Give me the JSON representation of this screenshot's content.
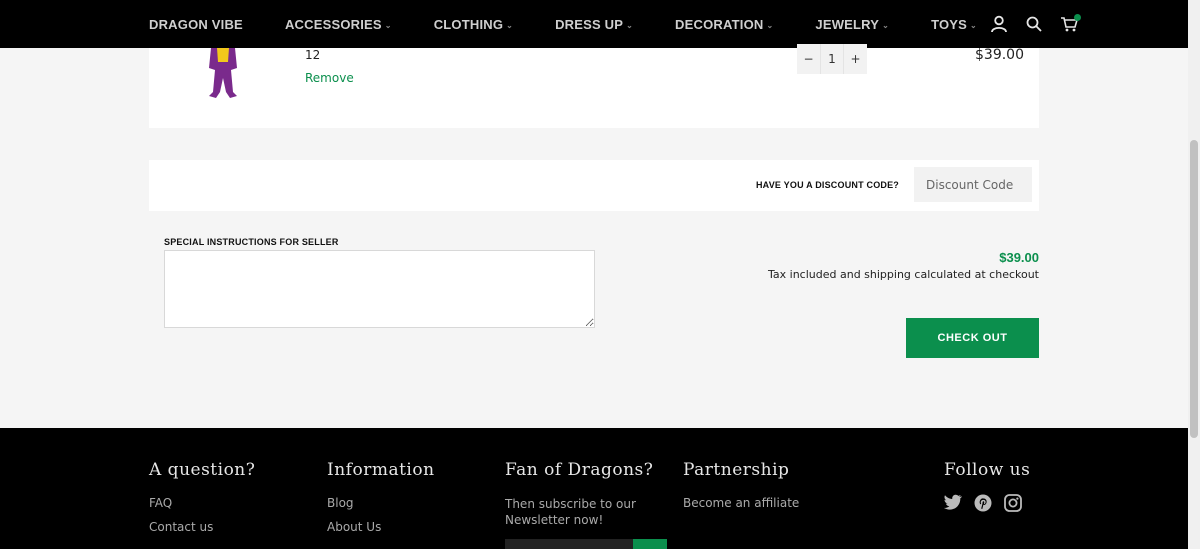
{
  "header": {
    "nav": [
      {
        "label": "DRAGON VIBE",
        "has_dropdown": false
      },
      {
        "label": "ACCESSORIES",
        "has_dropdown": true
      },
      {
        "label": "CLOTHING",
        "has_dropdown": true
      },
      {
        "label": "DRESS UP",
        "has_dropdown": true
      },
      {
        "label": "DECORATION",
        "has_dropdown": true
      },
      {
        "label": "JEWELRY",
        "has_dropdown": true
      },
      {
        "label": "TOYS",
        "has_dropdown": true
      }
    ],
    "icons": [
      "account-icon",
      "search-icon",
      "cart-icon"
    ]
  },
  "cart_item": {
    "variant": "12",
    "remove_label": "Remove",
    "qty_minus": "−",
    "quantity": "1",
    "qty_plus": "+",
    "line_price": "$39.00"
  },
  "discount": {
    "label": "HAVE YOU A DISCOUNT CODE?",
    "placeholder": "Discount Code"
  },
  "notes": {
    "label": "SPECIAL INSTRUCTIONS FOR SELLER"
  },
  "totals": {
    "subtotal": "$39.00",
    "tax_note": "Tax included and shipping calculated at checkout",
    "checkout_label": "CHECK OUT"
  },
  "footer": {
    "col1": {
      "heading": "A question?",
      "links": [
        "FAQ",
        "Contact us"
      ]
    },
    "col2": {
      "heading": "Information",
      "links": [
        "Blog",
        "About Us"
      ]
    },
    "col3": {
      "heading": "Fan of Dragons?",
      "text": "Then subscribe to our Newsletter now!"
    },
    "col4": {
      "heading": "Partnership",
      "links": [
        "Become an affiliate"
      ]
    },
    "col5": {
      "heading": "Follow us",
      "icons": [
        "twitter-icon",
        "pinterest-icon",
        "instagram-icon"
      ]
    }
  },
  "colors": {
    "accent": "#0b8f4d",
    "header_bg": "#000000",
    "page_bg": "#f5f5f5"
  }
}
